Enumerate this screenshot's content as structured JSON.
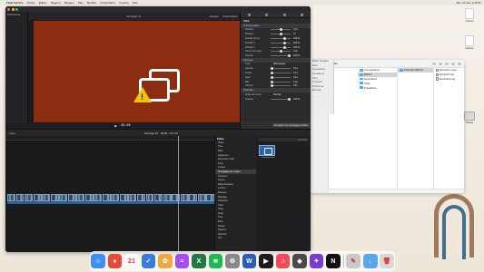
{
  "menubar": {
    "app_name": "Final Cut Pro",
    "menus": [
      "Fichier",
      "Édition",
      "Rapport",
      "Marquer",
      "Plan",
      "Modifier",
      "Présentation",
      "Fenêtre",
      "Aide"
    ],
    "clock": "Mer. 21 févr. à 15:57"
  },
  "desktop_icons": [
    {
      "label": "Capture"
    },
    {
      "label": "Capture"
    },
    {
      "label": "Disque"
    }
  ],
  "fcp": {
    "library_label": "Bibliothèque",
    "viewer_title": "Montage 01",
    "viewer_zoom": "Adapter",
    "viewer_view": "Présentation",
    "timecode": "29:06",
    "inspector": {
      "title": "Titre",
      "sections": [
        {
          "name": "Transformation",
          "rows": [
            {
              "label": "Position",
              "value": "0 px"
            },
            {
              "label": "Rotation",
              "value": "0 °"
            },
            {
              "label": "Échelle (tous)",
              "value": "100 %"
            },
            {
              "label": "Échelle X",
              "value": "100 %"
            },
            {
              "label": "Échelle Y",
              "value": "100 %"
            },
            {
              "label": "Point d'ancrage",
              "value": "0 px"
            },
            {
              "label": "Opacité",
              "value": "100 %"
            }
          ]
        },
        {
          "name": "Rognage",
          "rows": [
            {
              "label": "Type",
              "value": "Découpage"
            },
            {
              "label": "Gauche",
              "value": "0 px"
            },
            {
              "label": "Droite",
              "value": "0 px"
            },
            {
              "label": "Haut",
              "value": "0 px"
            },
            {
              "label": "Bas",
              "value": "0 px"
            },
            {
              "label": "Adoucir",
              "value": "0 %"
            }
          ]
        },
        {
          "name": "Distorsion",
          "rows": [
            {
              "label": "Mode de fusion",
              "value": "Normal"
            },
            {
              "label": "Opacité",
              "value": "100 %"
            }
          ]
        }
      ],
      "footer_button": "Enregistrer les préréglages d'effets"
    },
    "timeline": {
      "index_label": "Index",
      "project_name": "Montage 01",
      "duration": "29:06 / 1:07:19",
      "clip_count": 24
    },
    "effects": {
      "header": "Effets",
      "categories": [
        {
          "label": "Vidéo",
          "selected": false
        },
        {
          "label": "Tous",
          "selected": false
        },
        {
          "label": "Base",
          "selected": false
        },
        {
          "label": "Apparence",
          "selected": false
        },
        {
          "label": "Expression drôle",
          "selected": false
        },
        {
          "label": "Flous",
          "selected": false
        },
        {
          "label": "Couleur",
          "selected": false
        },
        {
          "label": "Préréglages de couleur",
          "selected": true
        },
        {
          "label": "Distorsion",
          "selected": false
        },
        {
          "label": "Keying",
          "selected": false
        },
        {
          "label": "Effets Keyframe",
          "selected": false
        },
        {
          "label": "Lumière",
          "selected": false
        },
        {
          "label": "Masques",
          "selected": false
        },
        {
          "label": "Nostalgie",
          "selected": false
        },
        {
          "label": "Stylisation",
          "selected": false
        },
        {
          "label": "Texte",
          "selected": false
        },
        {
          "label": "Tiling",
          "selected": false
        },
        {
          "label": "Audio",
          "selected": false
        },
        {
          "label": "Tous",
          "selected": false
        },
        {
          "label": "Écho",
          "selected": false
        },
        {
          "label": "Espace",
          "selected": false
        },
        {
          "label": "Niveaux",
          "selected": false
        },
        {
          "label": "Spéciaux",
          "selected": false
        },
        {
          "label": "Voix",
          "selected": false
        }
      ],
      "search_placeholder": "Chercher",
      "thumb_label": "Transformation",
      "item_count": "1 élément"
    }
  },
  "finder": {
    "title": "Effets",
    "sidebar": [
      "Favoris",
      "Récents",
      "Applications",
      "Bureau",
      "Documents",
      "Téléchargements",
      "iCloud",
      "Emplacements"
    ],
    "overlay_items": [
      "Motion Templates",
      "Effets",
      "Compositions",
      "Générateurs",
      "Titres",
      "Transitions",
      "Préférences",
      "Éléments"
    ],
    "col1": [
      {
        "label": "Compositions",
        "kind": "folder",
        "selected": false
      },
      {
        "label": "Effects",
        "kind": "folder",
        "selected": true
      },
      {
        "label": "Generators",
        "kind": "folder",
        "selected": false
      },
      {
        "label": "Titles",
        "kind": "folder",
        "selected": false
      },
      {
        "label": "Transitions",
        "kind": "folder",
        "selected": false
      }
    ],
    "col2": [
      {
        "label": "Eccentric Effects",
        "kind": "folder",
        "selected": true
      }
    ],
    "col3": [
      {
        "label": "Eccentric.moef",
        "kind": "doc",
        "selected": false
      },
      {
        "label": "Eccentric.fcp",
        "kind": "doc",
        "selected": false
      },
      {
        "label": "Eccentric.png",
        "kind": "doc",
        "selected": false
      }
    ]
  },
  "dock": {
    "apps": [
      {
        "name": "Finder",
        "glyph": "☺",
        "color": "#3f8ef5"
      },
      {
        "name": "Chrome",
        "glyph": "●",
        "color": "#e44a3b"
      },
      {
        "name": "Calendrier",
        "glyph": "21",
        "color": "#ffffff"
      },
      {
        "name": "Rappels",
        "glyph": "✓",
        "color": "#3b7bd8"
      },
      {
        "name": "Photos",
        "glyph": "✿",
        "color": "#f0a742"
      },
      {
        "name": "Messenger",
        "glyph": "≈",
        "color": "#a64cf0"
      },
      {
        "name": "Excel",
        "glyph": "X",
        "color": "#1f7a45"
      },
      {
        "name": "Spotify",
        "glyph": "≋",
        "color": "#1db954"
      },
      {
        "name": "Réglages",
        "glyph": "⚙",
        "color": "#8a8a8e"
      },
      {
        "name": "Word",
        "glyph": "W",
        "color": "#2b5fb5"
      },
      {
        "name": "Final Cut Pro",
        "glyph": "▶",
        "color": "#1c1c1e"
      },
      {
        "name": "Music",
        "glyph": "♫",
        "color": "#f34a5a"
      },
      {
        "name": "Compressor",
        "glyph": "◆",
        "color": "#4a4a4f"
      },
      {
        "name": "Motion",
        "glyph": "✦",
        "color": "#7b3bd1"
      },
      {
        "name": "Netflix",
        "glyph": "N",
        "color": "#111111"
      },
      {
        "name": "Scripts",
        "glyph": "✎",
        "color": "#c9c9c9"
      },
      {
        "name": "Téléchargements",
        "glyph": "↓",
        "color": "#58a7ee"
      },
      {
        "name": "Corbeille",
        "glyph": "🗑",
        "color": "#d8d8d8"
      }
    ]
  }
}
